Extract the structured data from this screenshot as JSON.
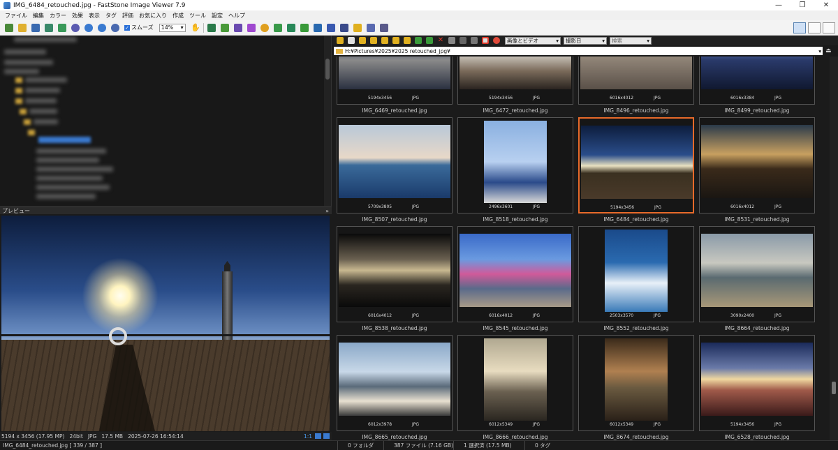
{
  "window": {
    "title": "IMG_6484_retouched.jpg - FastStone Image Viewer 7.9"
  },
  "menu": [
    "ファイル",
    "編集",
    "カラー",
    "効果",
    "表示",
    "タグ",
    "評価",
    "お気に入り",
    "作成",
    "ツール",
    "設定",
    "ヘルプ"
  ],
  "toolbar": {
    "smooth_label": "スムーズ",
    "zoom_value": "14%"
  },
  "browser_toolbar": {
    "filter_value": "画像とビデオ",
    "sort_value": "撮影日",
    "search_placeholder": "検索"
  },
  "path": "H:¥Pictures¥2025¥2025 retouched_jpg¥",
  "tree": {
    "visible_text": "(blurred)"
  },
  "preview": {
    "header": "プレビュー",
    "info": [
      "5194 x 3456 (17.95 MP)",
      "24bit",
      "JPG",
      "17.5 MB",
      "2025-07-26 16:54:14"
    ],
    "zoom_ratio": "1:1"
  },
  "thumbnails": [
    {
      "name": "IMG_6469_retouched.jpg",
      "res": "5194x3456",
      "fmt": "JPG",
      "bg": "linear-gradient(180deg,#0e1e3a 0%,#3a4a6a 40%,#8a8a8a 60%,#2a3040 100%)",
      "orient": "land"
    },
    {
      "name": "IMG_6472_retouched.jpg",
      "res": "5194x3456",
      "fmt": "JPG",
      "bg": "linear-gradient(180deg,#3a5a7a 0%,#8aa0b5 35%,#d8d4cc 50%,#7a6a5a 75%,#2a2420 100%)",
      "orient": "land"
    },
    {
      "name": "IMG_8496_retouched.jpg",
      "res": "6016x4012",
      "fmt": "JPG",
      "bg": "linear-gradient(180deg,#6a6058 0%,#9a8e80 50%,#5a5048 100%)",
      "orient": "land"
    },
    {
      "name": "IMG_8499_retouched.jpg",
      "res": "6016x3384",
      "fmt": "JPG",
      "bg": "linear-gradient(180deg,#3a6ac0 0%,#6a8ad0 40%,#2a3a6a 60%,#101830 100%)",
      "orient": "land"
    },
    {
      "name": "IMG_8507_retouched.jpg",
      "res": "5709x3805",
      "fmt": "JPG",
      "bg": "linear-gradient(180deg,#b8c8d8 0%,#e8d8c8 45%,#3a6a9a 55%,#1a3a6a 100%)",
      "orient": "land"
    },
    {
      "name": "IMG_8518_retouched.jpg",
      "res": "2496x3601",
      "fmt": "JPG",
      "bg": "linear-gradient(180deg,#8ab0e0 0%,#b8d0f0 50%,#2a4a8a 75%,#d8d8d8 100%)",
      "orient": "port"
    },
    {
      "name": "IMG_6484_retouched.jpg",
      "res": "5194x3456",
      "fmt": "JPG",
      "bg": "linear-gradient(180deg,#0d1d3d 0%,#2a4d8a 40%,#e8e0c0 55%,#3a3020 65%,#4a3a2a 100%)",
      "orient": "land",
      "selected": true
    },
    {
      "name": "IMG_8531_retouched.jpg",
      "res": "6016x4012",
      "fmt": "JPG",
      "bg": "linear-gradient(180deg,#2a3a4a 0%,#c8a060 40%,#3a2a1a 60%,#1a1612 100%)",
      "orient": "land"
    },
    {
      "name": "IMG_8538_retouched.jpg",
      "res": "6016x4012",
      "fmt": "JPG",
      "bg": "linear-gradient(180deg,#0a0a0a 0%,#6a6050 35%,#c8b890 50%,#2a2620 70%,#0a0a0a 100%)",
      "orient": "land"
    },
    {
      "name": "IMG_8545_retouched.jpg",
      "res": "6016x4012",
      "fmt": "JPG",
      "bg": "linear-gradient(180deg,#3a6ac8 0%,#6a9ae0 35%,#d05a9a 55%,#5a6a8a 75%,#a89a88 100%)",
      "orient": "land"
    },
    {
      "name": "IMG_8552_retouched.jpg",
      "res": "2503x3570",
      "fmt": "JPG",
      "bg": "linear-gradient(180deg,#1a4a8a 0%,#2a6ab0 40%,#e8f0f8 65%,#3a7ab8 100%)",
      "orient": "port"
    },
    {
      "name": "IMG_8664_retouched.jpg",
      "res": "3090x2400",
      "fmt": "JPG",
      "bg": "linear-gradient(180deg,#8a9aa8 0%,#c8c8c0 40%,#5a6a70 60%,#a89878 100%)",
      "orient": "land"
    },
    {
      "name": "IMG_8665_retouched.jpg",
      "res": "6012x3978",
      "fmt": "JPG",
      "bg": "linear-gradient(180deg,#8aa8c8 0%,#c8d8e8 40%,#5a6a7a 60%,#e8e0d0 80%,#3a3a3a 100%)",
      "orient": "land"
    },
    {
      "name": "IMG_8666_retouched.jpg",
      "res": "6012x5349",
      "fmt": "JPG",
      "bg": "linear-gradient(180deg,#b0a890 0%,#e8dcc0 40%,#6a6050 65%,#2a2620 100%)",
      "orient": "port"
    },
    {
      "name": "IMG_8674_retouched.jpg",
      "res": "6012x5349",
      "fmt": "JPG",
      "bg": "linear-gradient(180deg,#3a2a1a 0%,#b08050 40%,#6a5a40 60%,#2a2018 100%)",
      "orient": "port"
    },
    {
      "name": "IMG_6528_retouched.jpg",
      "res": "5194x3456",
      "fmt": "JPG",
      "bg": "linear-gradient(180deg,#1a2a5a 0%,#6a7aa8 35%,#f0d8a0 50%,#a05a4a 65%,#3a1a1a 100%)",
      "orient": "land"
    }
  ],
  "status": {
    "current": "IMG_6484_retouched.jpg [ 339 / 387 ]",
    "folders": "0 フォルダ",
    "files": "387 ファイル (7.16 GB)",
    "selected": "1 選択済 (17.5 MB)",
    "tags": "0 タグ"
  }
}
